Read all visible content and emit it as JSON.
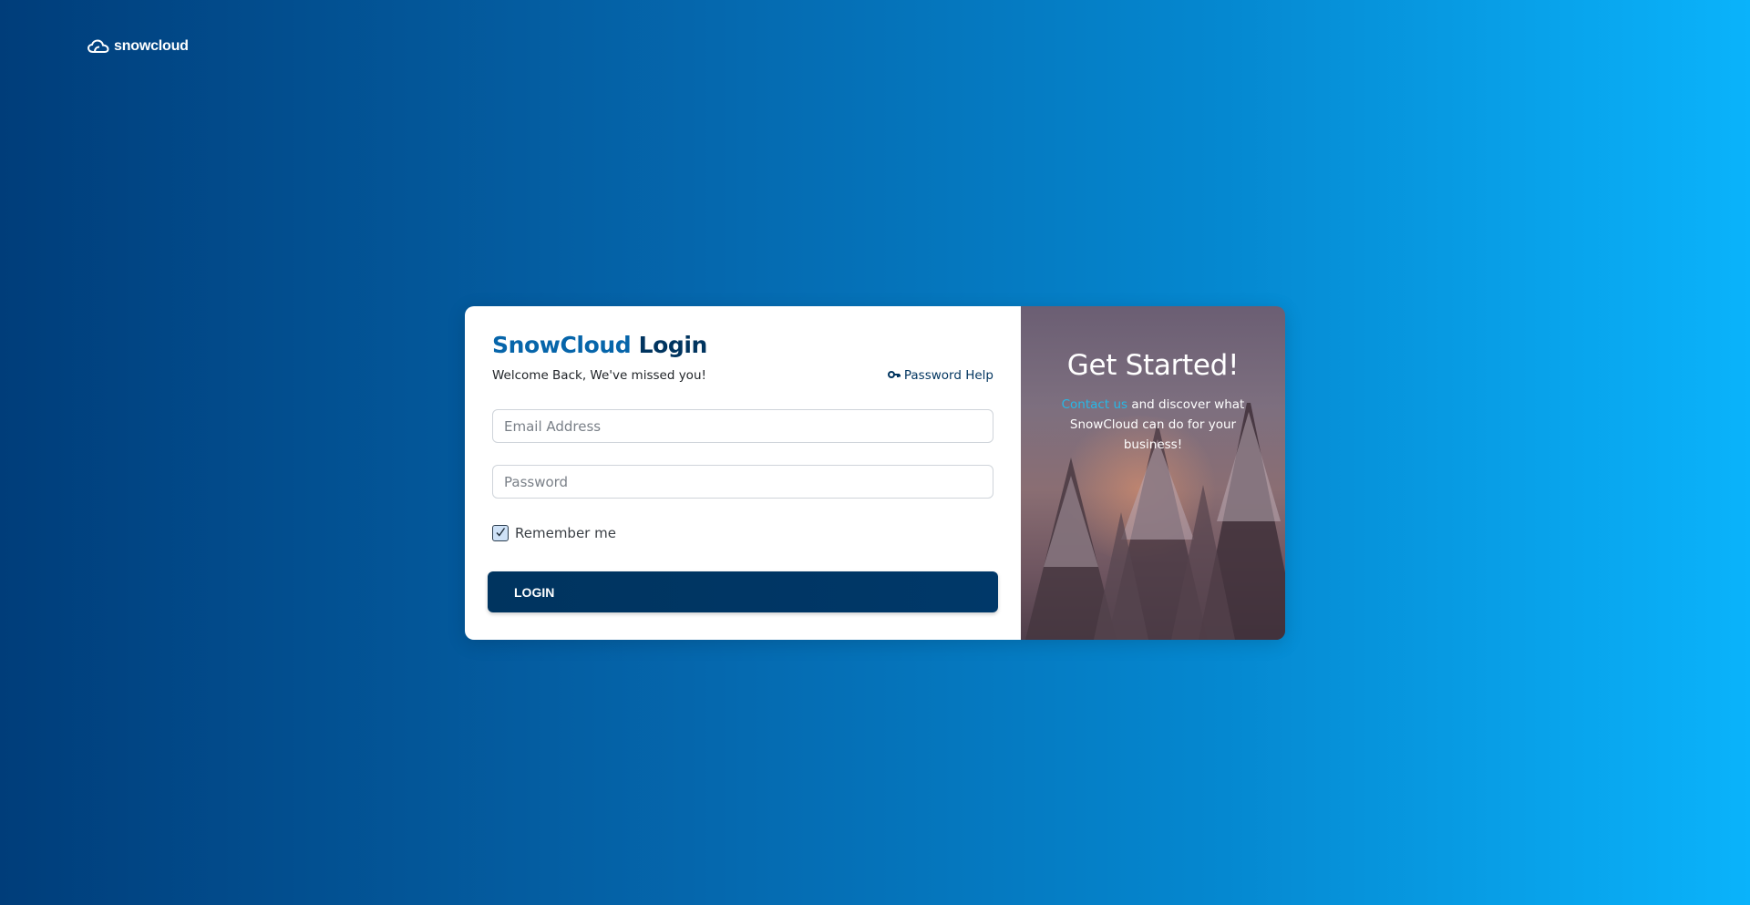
{
  "brand": {
    "logo_text": "snowcloud"
  },
  "login": {
    "title_brand": "SnowCloud",
    "title_word": "Login",
    "welcome": "Welcome Back, We've missed you!",
    "password_help": "Password Help",
    "email_placeholder": "Email Address",
    "email_value": "",
    "password_placeholder": "Password",
    "password_value": "",
    "remember_label": "Remember me",
    "remember_checked": true,
    "button_label": "LOGIN"
  },
  "promo": {
    "title": "Get Started!",
    "contact_link": "Contact us",
    "text": " and discover what SnowCloud can do for your business!"
  },
  "colors": {
    "brand_blue": "#0665aa",
    "navy": "#00345f",
    "link_cyan": "#26b9e7"
  },
  "icons": {
    "logo": "cloud-icon",
    "password_help": "key-icon",
    "remember": "checkmark-icon"
  }
}
